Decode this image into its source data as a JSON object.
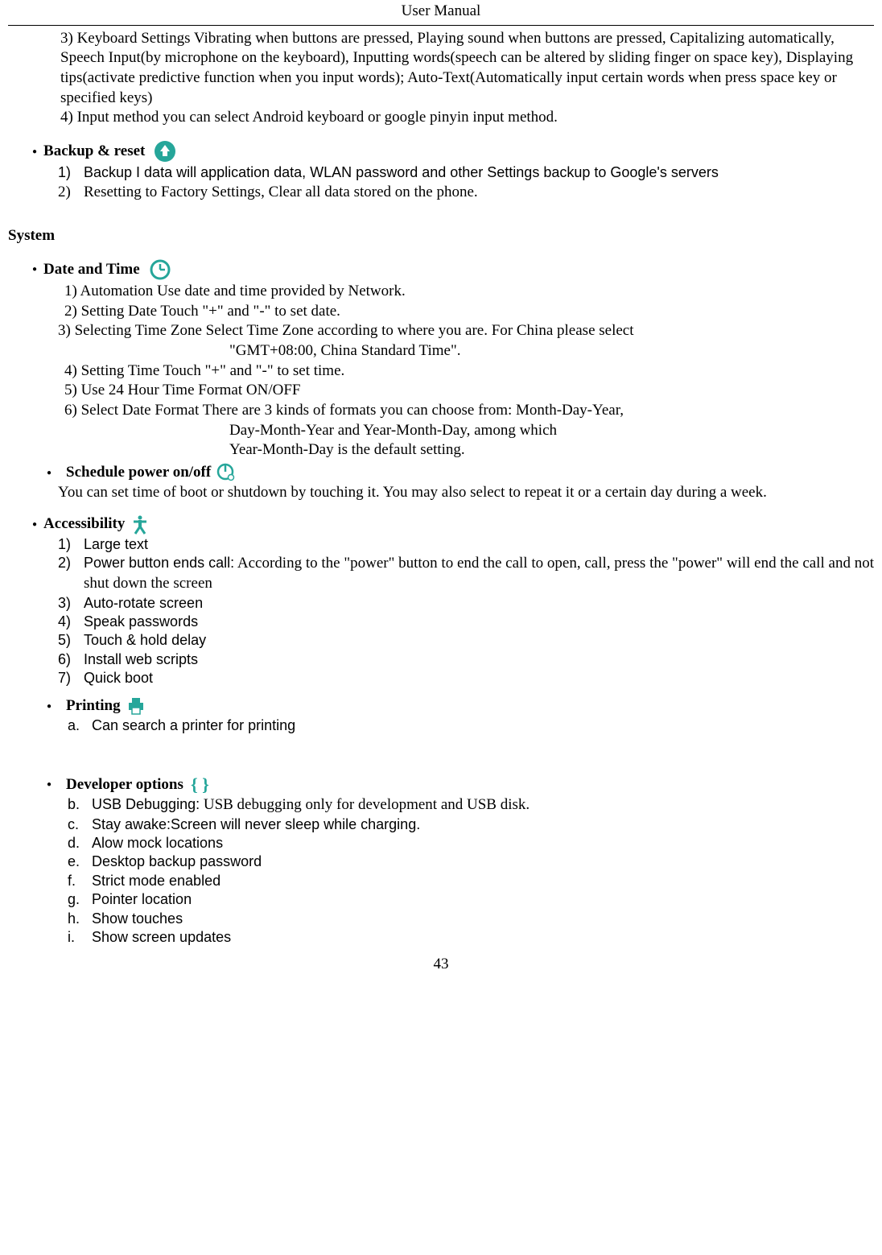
{
  "header": "User    Manual",
  "p3": "3) Keyboard Settings         Vibrating when buttons are pressed, Playing sound when buttons are pressed, Capitalizing automatically, Speech Input(by microphone on the keyboard), Inputting words(speech can be altered by sliding finger on space key), Displaying tips(activate predictive function when you input words); Auto-Text(Automatically input certain words when press space key or specified keys)",
  "p4": "4) Input method         you can select Android keyboard or google pinyin input method.",
  "backup": {
    "heading": "Backup & reset",
    "i1_num": "1)",
    "i1_text": "Backup I data will application data, WLAN password and other Settings backup to Google's servers",
    "i2_num": "2)",
    "i2_text": "Resetting to Factory Settings, Clear all data stored on the phone."
  },
  "system_heading": "System",
  "datetime": {
    "heading": "Date and Time",
    "i1": "1) Automation        Use date and time provided by Network.",
    "i2": "2) Setting Date        Touch \"+\" and \"-\" to set date.",
    "i3a": "3) Selecting Time Zone        Select Time Zone according to where you are. For China please select",
    "i3b": "\"GMT+08:00, China Standard Time\".",
    "i4": "4) Setting Time        Touch \"+\" and \"-\" to set time.",
    "i5": "5) Use 24 Hour Time Format        ON/OFF",
    "i6a": "6) Select Date Format        There are 3 kinds of formats you can choose from: Month-Day-Year,",
    "i6b": "Day-Month-Year      and      Year-Month-Day,      among      which",
    "i6c": "Year-Month-Day is the default setting."
  },
  "schedule": {
    "heading": "Schedule power on/off",
    "text": "You can set time of boot or shutdown by touching it. You may also select to repeat it or a certain day during a week."
  },
  "accessibility": {
    "heading": "Accessibility",
    "i1_num": "1)",
    "i1_text": "Large text",
    "i2_num": "2)",
    "i2_text_a": "Power button ends call:",
    "i2_text_b": " According to the \"power\" button to end the call to open, call, press the \"power\" will end the call and not shut down the screen",
    "i3_num": "3)",
    "i3_text": "Auto-rotate screen",
    "i4_num": "4)",
    "i4_text": "Speak passwords",
    "i5_num": "5)",
    "i5_text": "Touch & hold delay",
    "i6_num": "6)",
    "i6_text": "Install web scripts",
    "i7_num": "7)",
    "i7_text": "Quick boot"
  },
  "printing": {
    "heading": "Printing",
    "a_num": "a.",
    "a_text": "Can search a printer for printing"
  },
  "developer": {
    "heading": "Developer    options",
    "b_num": "b.",
    "b_text_a": "USB Debugging:",
    "b_text_b": " USB debugging only for development and USB disk.",
    "c_num": "c.",
    "c_text": "Stay awake:Screen will never sleep while charging.",
    "d_num": "d.",
    "d_text": "Alow mock locations",
    "e_num": "e.",
    "e_text": "Desktop backup password",
    "f_num": "f.",
    "f_text": "Strict mode enabled",
    "g_num": "g.",
    "g_text": "Pointer location",
    "h_num": "h.",
    "h_text": "Show touches",
    "i_num": "i.",
    "i_text": "Show screen updates"
  },
  "page_number": "43"
}
